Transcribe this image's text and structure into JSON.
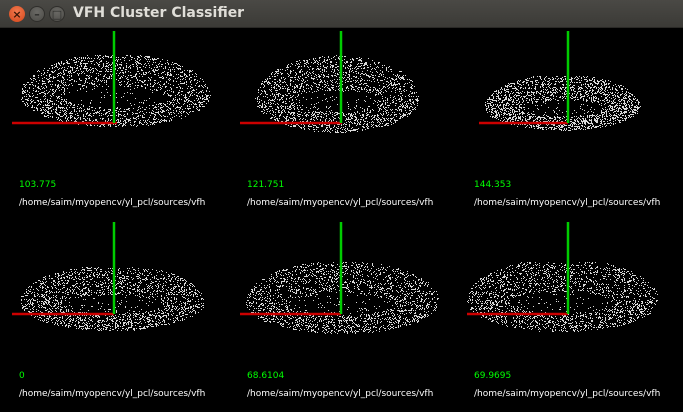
{
  "window": {
    "title": "VFH Cluster Classifier",
    "close_glyph": "×",
    "min_glyph": "–",
    "max_glyph": "□"
  },
  "colors": {
    "score_text": "#00ff00",
    "path_text": "#ffffff",
    "x_axis": "#cc0000",
    "y_axis": "#00cc00",
    "points": "#ffffff"
  },
  "clusters": [
    {
      "score": "103.775",
      "path": "/home/saim/myopencv/yl_pcl/sources/vfh"
    },
    {
      "score": "121.751",
      "path": "/home/saim/myopencv/yl_pcl/sources/vfh"
    },
    {
      "score": "144.353",
      "path": "/home/saim/myopencv/yl_pcl/sources/vfh"
    },
    {
      "score": "0",
      "path": "/home/saim/myopencv/yl_pcl/sources/vfh"
    },
    {
      "score": "68.6104",
      "path": "/home/saim/myopencv/yl_pcl/sources/vfh"
    },
    {
      "score": "69.9695",
      "path": "/home/saim/myopencv/yl_pcl/sources/vfh"
    }
  ]
}
